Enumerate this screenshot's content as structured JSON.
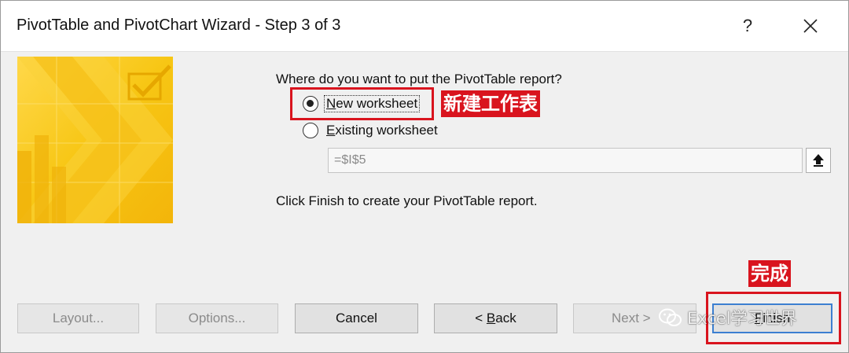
{
  "dialog": {
    "title": "PivotTable and PivotChart Wizard - Step 3 of 3",
    "help_label": "?",
    "prompt": "Where do you want to put the PivotTable report?",
    "options": {
      "new_accel": "N",
      "new_rest": "ew worksheet",
      "existing_accel": "E",
      "existing_rest": "xisting worksheet",
      "selected": "New worksheet"
    },
    "reference_value": "=$I$5",
    "finish_note": "Click Finish to create your PivotTable report."
  },
  "buttons": {
    "layout": "Layout...",
    "options": "Options...",
    "cancel": "Cancel",
    "back_prefix": "< ",
    "back_accel": "B",
    "back_rest": "ack",
    "next": "Next >",
    "finish_accel": "F",
    "finish_rest": "inish"
  },
  "annotations": {
    "new_worksheet_tag": "新建工作表",
    "finish_tag": "完成"
  },
  "watermark": {
    "text": "Excel学习世界"
  },
  "colors": {
    "annotation_red": "#d9141e",
    "art_yellow": "#f7c614",
    "finish_focus_border": "#3c7fd1"
  },
  "icons": {
    "close": "close-icon",
    "collapse_dialog": "collapse-dialog-icon",
    "wizard_art": "wizard-illustration-icon",
    "watermark_logo": "wechat-logo-icon"
  }
}
